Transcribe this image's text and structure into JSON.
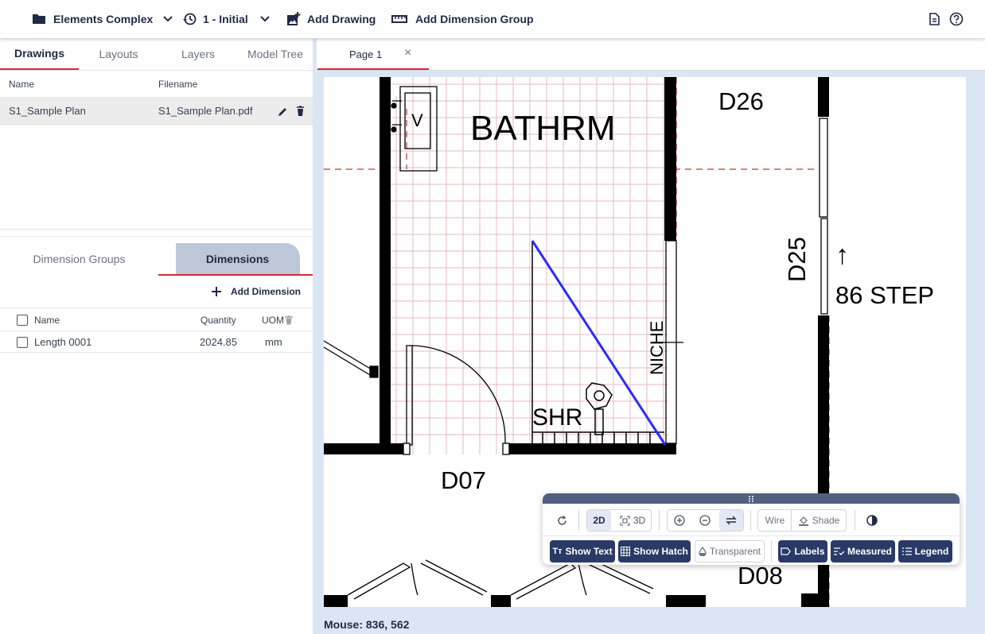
{
  "topbar": {
    "project_name": "Elements Complex",
    "version": "1 - Initial",
    "add_drawing": "Add Drawing",
    "add_dimension_group": "Add Dimension Group"
  },
  "left_tabs": [
    "Drawings",
    "Layouts",
    "Layers",
    "Model Tree"
  ],
  "drawings_table": {
    "headers": {
      "name": "Name",
      "filename": "Filename"
    },
    "rows": [
      {
        "name": "S1_Sample Plan",
        "filename": "S1_Sample Plan.pdf"
      }
    ]
  },
  "lower_tabs": [
    "Dimension Groups",
    "Dimensions"
  ],
  "add_dimension": "Add Dimension",
  "dimensions_table": {
    "headers": {
      "name": "Name",
      "quantity": "Quantity",
      "uom": "UOM"
    },
    "rows": [
      {
        "name": "Length 0001",
        "quantity": "2024.85",
        "uom": "mm"
      }
    ]
  },
  "page_tab": {
    "label": "Page 1",
    "close": "×"
  },
  "plan_labels": {
    "bathrm": "BATHRM",
    "d26": "D26",
    "d25": "D25",
    "step": "86 STEP",
    "niche": "NICHE",
    "shr": "SHR",
    "d07": "D07",
    "d08": "D08",
    "v": "V",
    "arrow": "↑"
  },
  "float_toolbar": {
    "mode_2d": "2D",
    "mode_3d": "3D",
    "wire": "Wire",
    "shade": "Shade",
    "show_text": "Show Text",
    "show_hatch": "Show Hatch",
    "transparent": "Transparent",
    "labels": "Labels",
    "measured": "Measured",
    "legend": "Legend",
    "tt_glyph": "Tт"
  },
  "status": {
    "mouse": "Mouse: 836, 562"
  },
  "colors": {
    "accent_red": "#d8283a",
    "dark_navy": "#2a3a66",
    "measure_line": "#2b2bff",
    "panel_bg": "#dbe6f5"
  }
}
